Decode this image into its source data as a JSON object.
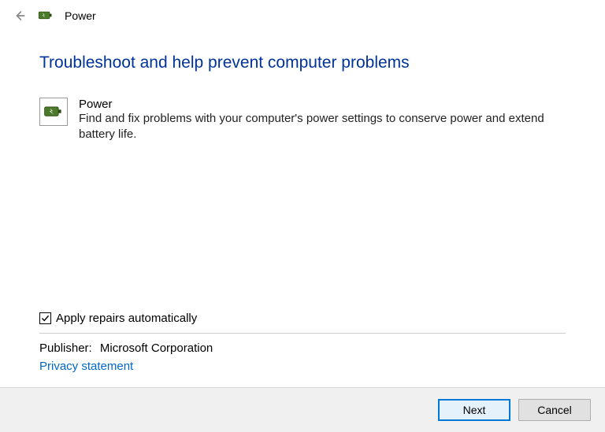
{
  "header": {
    "title": "Power"
  },
  "main": {
    "heading": "Troubleshoot and help prevent computer problems",
    "troubleshooter": {
      "title": "Power",
      "description": "Find and fix problems with your computer's power settings to conserve power and extend battery life."
    },
    "apply_repairs": {
      "checked": true,
      "label": "Apply repairs automatically"
    },
    "publisher": {
      "label": "Publisher:",
      "value": "Microsoft Corporation"
    },
    "privacy_link": "Privacy statement"
  },
  "footer": {
    "next_label": "Next",
    "cancel_label": "Cancel"
  }
}
